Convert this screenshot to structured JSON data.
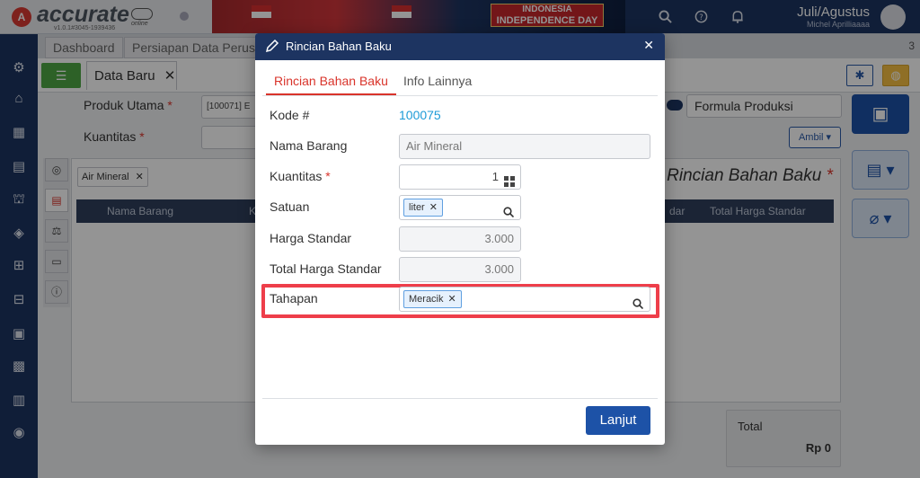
{
  "app": {
    "logo_mark": "A",
    "brand": "accurate",
    "brand_sub": "online",
    "version": "v1.0.1#3045-1939436",
    "banner_line1": "INDONESIA",
    "banner_line2": "INDEPENDENCE DAY",
    "user_name": "Juli/Agustus",
    "user_sub": "Michel Aprilliaaaa"
  },
  "tabs": {
    "dashboard": "Dashboard",
    "persiapan": "Persiapan Data Perusahaan",
    "count": "3"
  },
  "subtab": {
    "title": "Data Baru"
  },
  "form": {
    "produk_utama_label": "Produk Utama",
    "produk_utama_value": "[100071] E",
    "kuantitas_label": "Kuantitas",
    "formula_label": "Formula Produksi",
    "ambil_label": "Ambil",
    "filter_chip": "Air Mineral",
    "panel_title": "Rincian Bahan Baku",
    "col_nama_barang": "Nama Barang",
    "col_k": "K",
    "col_standar": "dar",
    "col_total_harga": "Total Harga Standar",
    "total_label": "Total",
    "total_value": "Rp 0"
  },
  "modal": {
    "title": "Rincian Bahan Baku",
    "tab_rincian": "Rincian Bahan Baku",
    "tab_info": "Info Lainnya",
    "kode_label": "Kode #",
    "kode_value": "100075",
    "nama_label": "Nama Barang",
    "nama_value": "Air Mineral",
    "kuantitas_label": "Kuantitas",
    "kuantitas_value": "1",
    "satuan_label": "Satuan",
    "satuan_chip": "liter",
    "harga_label": "Harga Standar",
    "harga_value": "3.000",
    "total_label": "Total Harga Standar",
    "total_value": "3.000",
    "tahapan_label": "Tahapan",
    "tahapan_chip": "Meracik",
    "lanjut_label": "Lanjut"
  },
  "colors": {
    "navy": "#1d3461",
    "accent_red": "#d9342b",
    "primary_blue": "#1d52a7",
    "link_blue": "#1d9bd7",
    "highlight": "#ee3e4a"
  }
}
